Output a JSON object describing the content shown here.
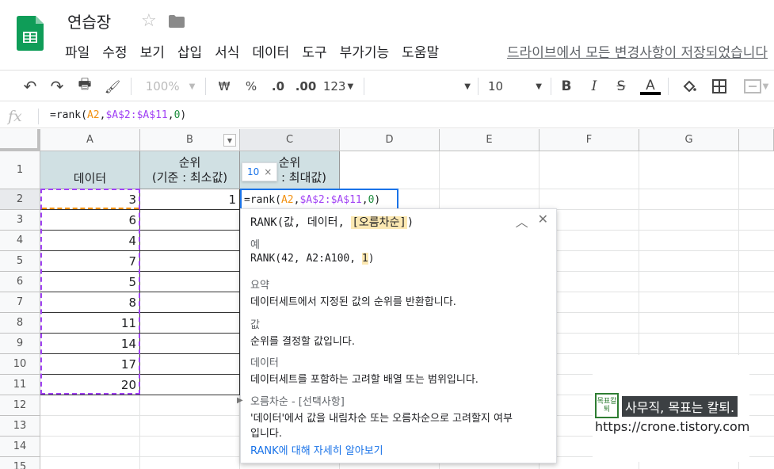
{
  "app": {
    "doc_title": "연습장",
    "menu": [
      "파일",
      "수정",
      "보기",
      "삽입",
      "서식",
      "데이터",
      "도구",
      "부가기능",
      "도움말"
    ],
    "save_status": "드라이브에서 모든 변경사항이 저장되었습니다"
  },
  "toolbar": {
    "undo": "↶",
    "redo": "↷",
    "print": "🖶",
    "paint": "🖌",
    "zoom": "100%",
    "currency": "₩",
    "percent": "%",
    "dec_less": ".0",
    "dec_more": ".00",
    "format_more": "123",
    "font_size": "10",
    "bold": "B",
    "italic": "I",
    "strike": "S",
    "text_color": "A"
  },
  "formula_bar": {
    "fx": "fx",
    "prefix": "=rank(",
    "ref_a2": "A2",
    "comma1": ",",
    "ref_range": "$A$2:$A$11",
    "comma2": ",",
    "ref_num": "0",
    "suffix": ")"
  },
  "columns": [
    "A",
    "B",
    "C",
    "D",
    "E",
    "F",
    "G"
  ],
  "rows": [
    "1",
    "2",
    "3",
    "4",
    "5",
    "6",
    "7",
    "8",
    "9",
    "10",
    "11",
    "12",
    "13",
    "14",
    "15"
  ],
  "cells": {
    "a1": "데이터",
    "b1_line1": "순위",
    "b1_line2": "(기준 : 최소값)",
    "c1_line1": "순위",
    "c1_line2": "최대값)",
    "c1_prefix": ": ",
    "b2": "1",
    "data": [
      "3",
      "6",
      "4",
      "7",
      "5",
      "8",
      "11",
      "14",
      "17",
      "20"
    ]
  },
  "edit_cell": {
    "prefix": "=rank(",
    "ref_a2": "A2",
    "comma1": ",",
    "ref_range": "$A$2:$A$11",
    "comma2": ",",
    "ref_num": "0",
    "suffix": ")"
  },
  "result_tip": {
    "value": "10",
    "close": "×"
  },
  "help": {
    "sig_prefix": "RANK(값, 데이터, ",
    "sig_opt": "[오름차순]",
    "sig_suffix": ")",
    "example_label": "예",
    "example_prefix": "RANK(42, A2:A100, ",
    "example_hl": "1",
    "example_suffix": ")",
    "summary_label": "요약",
    "summary_text": "데이터세트에서 지정된 값의 순위를 반환합니다.",
    "value_label": "값",
    "value_text": "순위를 결정할 값입니다.",
    "data_label": "데이터",
    "data_text": "데이터세트를 포함하는 고려할 배열 또는 범위입니다.",
    "asc_label": "오름차순 - [선택사항]",
    "asc_text_1": "'데이터'에서 값을 내림차순 또는 오름차순으로 고려할지 여부",
    "asc_text_2": "입니다.",
    "link": "RANK에 대해 자세히 알아보기"
  },
  "watermark": {
    "logo_text": "목표칼퇴",
    "slogan": "사무직, 목표는 칼퇴.",
    "url": "https://crone.tistory.com"
  }
}
